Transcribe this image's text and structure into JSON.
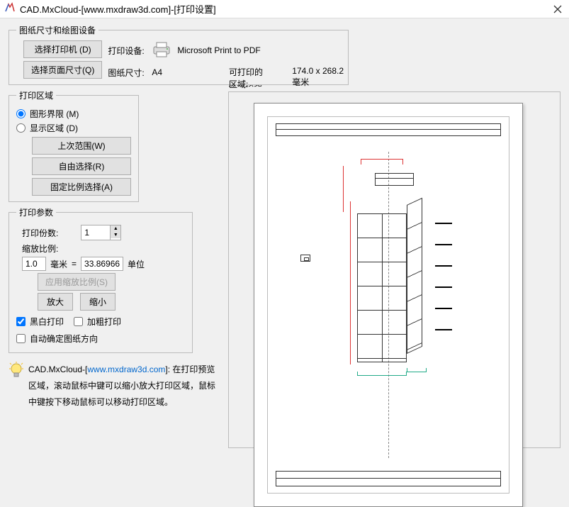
{
  "window": {
    "title": "CAD.MxCloud-[www.mxdraw3d.com]-[打印设置]"
  },
  "paper_group": {
    "legend": "图纸尺寸和绘图设备",
    "select_printer_btn": "选择打印机 (D)",
    "select_page_btn": "选择页面尺寸(Q)",
    "device_label": "打印设备:",
    "device_value": "Microsoft Print to PDF",
    "size_label": "图纸尺寸:",
    "size_value": "A4",
    "printable_label": "可打印的区域:",
    "printable_value": "174.0 x 268.2 毫米"
  },
  "area_group": {
    "legend": "打印区域",
    "radio_limits": "图形界限 (M)",
    "radio_display": "显示区域 (D)",
    "btn_last": "上次范围(W)",
    "btn_free": "自由选择(R)",
    "btn_fixed": "固定比例选择(A)"
  },
  "params": {
    "legend": "打印参数",
    "copies_label": "打印份数:",
    "copies_value": "1",
    "scale_label": "缩放比例:",
    "scale_left": "1.0",
    "scale_unit1": "毫米",
    "scale_eq": "=",
    "scale_right": "33.86966",
    "scale_unit2": "单位",
    "apply_scale_btn": "应用缩放比例(S)",
    "zoom_in_btn": "放大",
    "zoom_out_btn": "缩小",
    "check_bw": "黑白打印",
    "check_bold": "加粗打印",
    "check_auto_orient": "自动确定图纸方向"
  },
  "hint": {
    "prefix": "CAD.MxCloud-[",
    "link": "www.mxdraw3d.com",
    "suffix": "]:",
    "body": "在打印预览区域，滚动鼠标中键可以缩小放大打印区域，鼠标中键按下移动鼠标可以移动打印区域。"
  },
  "preview": {
    "legend": "打印预览"
  }
}
